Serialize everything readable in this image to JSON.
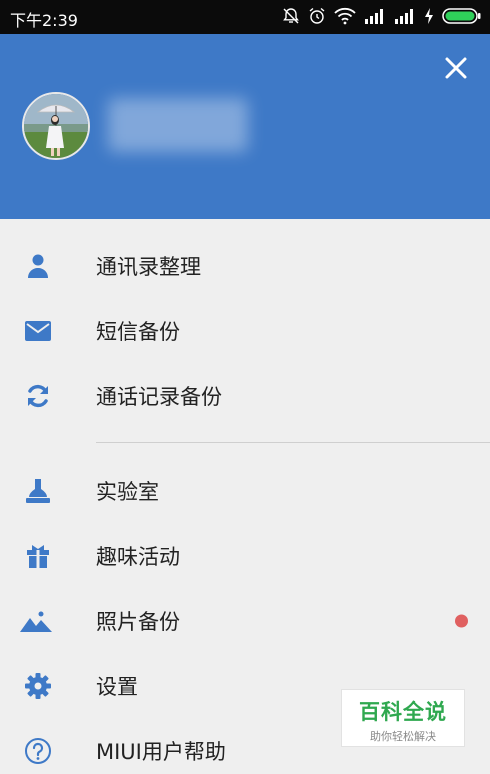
{
  "status_bar": {
    "time": "下午2:39",
    "icons": [
      "alarm-off-icon",
      "alarm-clock-icon",
      "wifi-icon",
      "signal-icon",
      "signal-icon",
      "charging-icon",
      "battery-icon"
    ]
  },
  "header": {
    "background": "#3e79c7",
    "close_icon": "close-icon"
  },
  "menu": {
    "items": [
      {
        "label": "通讯录整理",
        "icon": "person-icon"
      },
      {
        "label": "短信备份",
        "icon": "mail-icon"
      },
      {
        "label": "通话记录备份",
        "icon": "sync-icon"
      },
      {
        "label": "实验室",
        "icon": "flask-icon"
      },
      {
        "label": "趣味活动",
        "icon": "gift-icon"
      },
      {
        "label": "照片备份",
        "icon": "mountain-icon",
        "badge": "red-dot"
      },
      {
        "label": "设置",
        "icon": "gear-icon"
      },
      {
        "label": "MIUI用户帮助",
        "icon": "help-icon"
      }
    ],
    "icon_color": "#3e79c7",
    "badge_color": "#e06060"
  },
  "watermark": {
    "title": "百科全说",
    "subtitle": "助你轻松解决"
  }
}
